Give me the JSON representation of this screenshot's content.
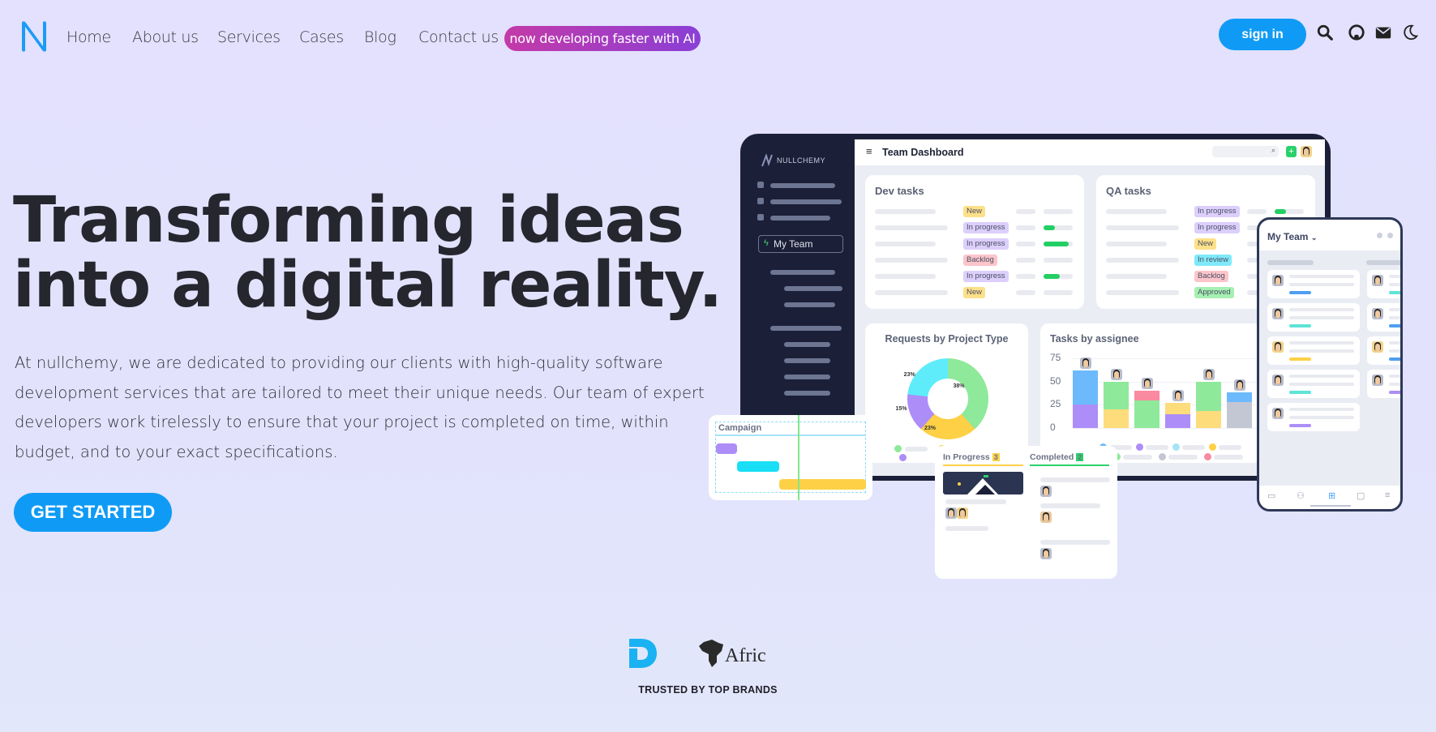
{
  "nav": {
    "items": [
      "Home",
      "About us",
      "Services",
      "Cases",
      "Blog",
      "Contact us"
    ],
    "ai_badge": "now developing faster with AI",
    "sign_in": "sign in",
    "icons": [
      "search-icon",
      "github-icon",
      "mail-icon",
      "moon-icon"
    ]
  },
  "hero": {
    "title_line1": "Transforming ideas",
    "title_line2": "into a digital reality.",
    "lead": "At nullchemy, we are dedicated to providing our clients with high-quality software development services that are tailored to meet their unique needs. Our team of expert developers work tirelessly to ensure that your project is completed on time, within budget, and to your exact specifications.",
    "cta": "GET STARTED"
  },
  "dashboard": {
    "brand": "NULLCHEMY",
    "title": "Team Dashboard",
    "team_select": "My Team",
    "dev": {
      "title": "Dev tasks",
      "rows": [
        {
          "status": "New",
          "progress": 0
        },
        {
          "status": "In progress",
          "progress": 0.4
        },
        {
          "status": "In progress",
          "progress": 0.85
        },
        {
          "status": "Backlog",
          "progress": 0
        },
        {
          "status": "In progress",
          "progress": 0.55
        },
        {
          "status": "New",
          "progress": 0
        }
      ]
    },
    "qa": {
      "title": "QA tasks",
      "rows": [
        {
          "status": "In progress",
          "progress": 0.4
        },
        {
          "status": "In progress",
          "progress": 0
        },
        {
          "status": "New",
          "progress": 0
        },
        {
          "status": "In review",
          "progress": 0
        },
        {
          "status": "Backlog",
          "progress": 0
        },
        {
          "status": "Approved",
          "progress": 0
        }
      ]
    },
    "status_colors": {
      "New": "#fde08a",
      "In progress": "#dccffc",
      "Backlog": "#fbc5ca",
      "In review": "#7fe9fa",
      "Approved": "#a6f0b1"
    },
    "donut": {
      "title": "Requests by Project Type",
      "slices": [
        {
          "label": "38%",
          "value": 38,
          "color": "#8ee99a"
        },
        {
          "label": "23%",
          "value": 23,
          "color": "#fdd046"
        },
        {
          "label": "15%",
          "value": 15,
          "color": "#ad8df7"
        },
        {
          "label": "23%",
          "value": 23,
          "color": "#5eecfb"
        }
      ]
    },
    "bars": {
      "title": "Tasks by assignee",
      "ticks": [
        "75",
        "50",
        "25",
        "0"
      ],
      "ymax": 75,
      "stacks": [
        [
          {
            "v": 25,
            "c": "#ad8df7"
          },
          {
            "v": 37,
            "c": "#6cbafb"
          }
        ],
        [
          {
            "v": 20,
            "c": "#fddc7c"
          },
          {
            "v": 30,
            "c": "#8ee99a"
          }
        ],
        [
          {
            "v": 30,
            "c": "#8ee99a"
          },
          {
            "v": 10,
            "c": "#f98aa0"
          }
        ],
        [
          {
            "v": 15,
            "c": "#ad8df7"
          },
          {
            "v": 12,
            "c": "#fddc7c"
          }
        ],
        [
          {
            "v": 18,
            "c": "#fddc7c"
          },
          {
            "v": 32,
            "c": "#8ee99a"
          }
        ],
        [
          {
            "v": 28,
            "c": "#c3c7d3"
          },
          {
            "v": 10,
            "c": "#6cbafb"
          }
        ]
      ]
    },
    "campaign": "Campaign",
    "kanban": {
      "in_progress": "In Progress",
      "in_progress_count": "3",
      "completed": "Completed",
      "completed_count": "2"
    },
    "phone_title": "My Team"
  },
  "brands": {
    "logos": [
      "D",
      "Afric"
    ],
    "caption": "TRUSTED BY TOP BRANDS"
  }
}
